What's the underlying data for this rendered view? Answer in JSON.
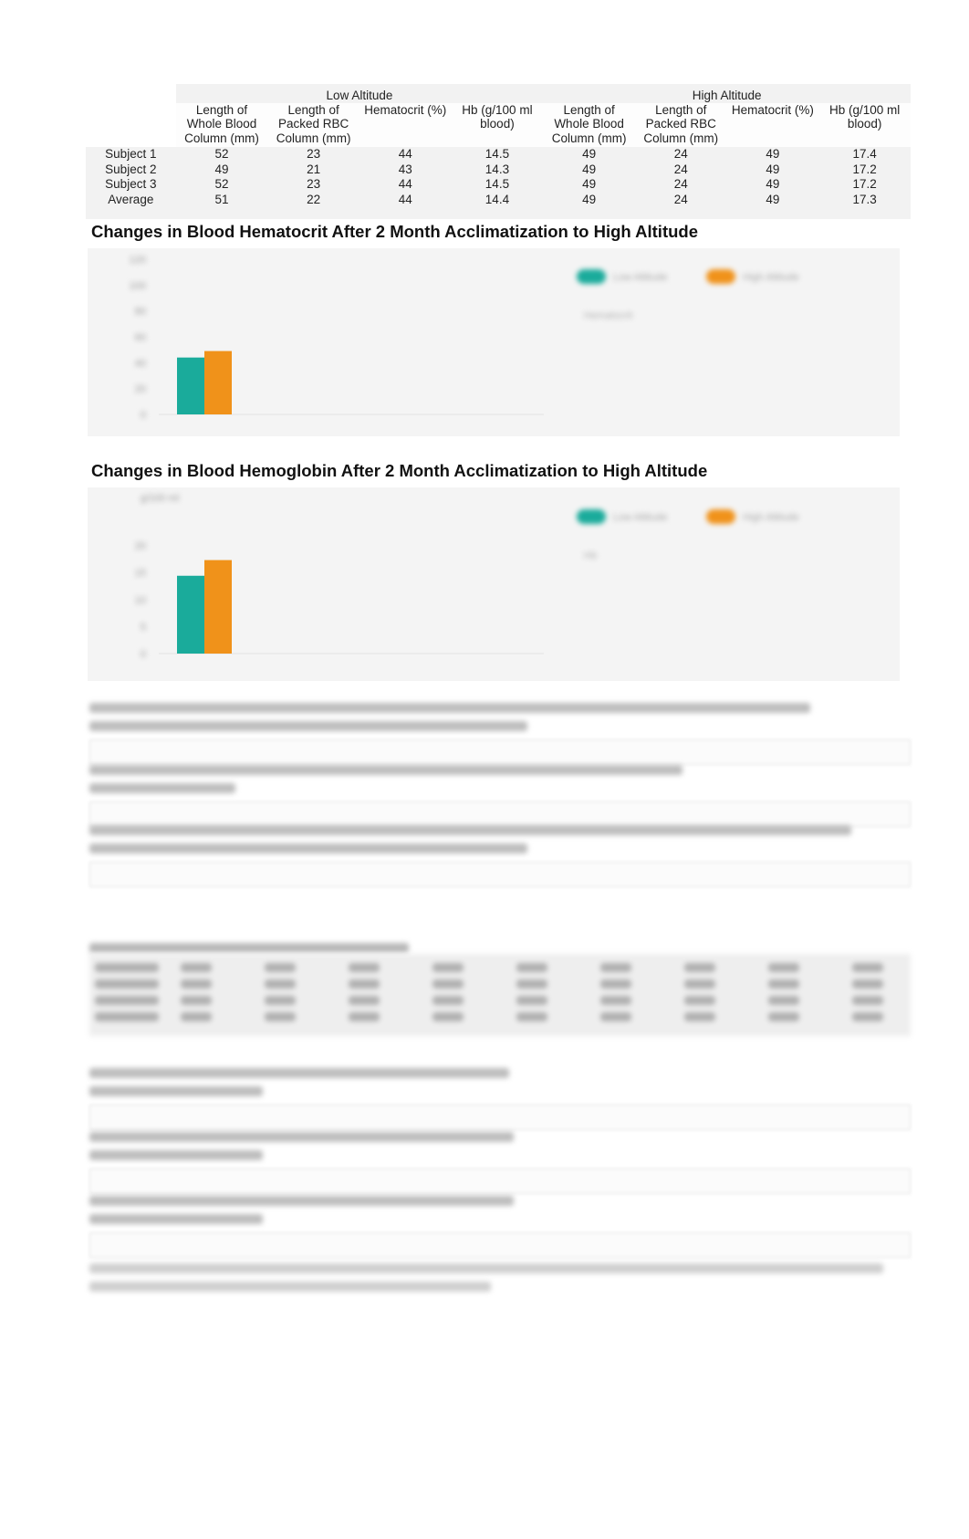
{
  "table": {
    "groups": [
      "Low Altitude",
      "High Altitude"
    ],
    "columns": [
      "Length of Whole Blood Column (mm)",
      "Length of Packed RBC Column (mm)",
      "Hematocrit (%)",
      "Hb (g/100 ml blood)"
    ],
    "column_lines": [
      [
        "Length of",
        "Whole Blood",
        "Column (mm)"
      ],
      [
        "Length of",
        "Packed RBC",
        "Column (mm)"
      ],
      [
        "Hematocrit (%)",
        "",
        ""
      ],
      [
        "Hb (g/100 ml",
        "blood)",
        ""
      ]
    ],
    "rows": [
      {
        "label": "Subject 1",
        "low": [
          "52",
          "23",
          "44",
          "14.5"
        ],
        "high": [
          "49",
          "24",
          "49",
          "17.4"
        ]
      },
      {
        "label": "Subject 2",
        "low": [
          "49",
          "21",
          "43",
          "14.3"
        ],
        "high": [
          "49",
          "24",
          "49",
          "17.2"
        ]
      },
      {
        "label": "Subject 3",
        "low": [
          "52",
          "23",
          "44",
          "14.5"
        ],
        "high": [
          "49",
          "24",
          "49",
          "17.2"
        ]
      },
      {
        "label": "Average",
        "low": [
          "51",
          "22",
          "44",
          "14.4"
        ],
        "high": [
          "49",
          "24",
          "49",
          "17.3"
        ]
      }
    ]
  },
  "colors": {
    "low_altitude": "#1aab9b",
    "high_altitude": "#f0921a",
    "panel_bg": "#f4f4f4"
  },
  "chart_data": [
    {
      "type": "bar",
      "title": "Changes in Blood Hematocrit After 2 Month Acclimatization to High Altitude",
      "categories": [
        ""
      ],
      "series": [
        {
          "name": "Low Altitude",
          "values": [
            44
          ]
        },
        {
          "name": "High Altitude",
          "values": [
            49
          ]
        }
      ],
      "ylim": [
        0,
        120
      ],
      "yticks": [
        0,
        20,
        40,
        60,
        80,
        100,
        120
      ],
      "xlabel": "",
      "ylabel": "",
      "legend": [
        "Low Altitude",
        "High Altitude",
        "Hematocrit"
      ],
      "legend_position": "top-right",
      "grid": false
    },
    {
      "type": "bar",
      "title": "Changes in Blood Hemoglobin After 2 Month Acclimatization to High Altitude",
      "categories": [
        ""
      ],
      "series": [
        {
          "name": "Low Altitude",
          "values": [
            14.4
          ]
        },
        {
          "name": "High Altitude",
          "values": [
            17.3
          ]
        }
      ],
      "ylim": [
        0,
        25
      ],
      "yticks": [
        0,
        5,
        10,
        15,
        20
      ],
      "xlabel": "",
      "ylabel": "g/100 ml",
      "legend": [
        "Low Altitude",
        "High Altitude",
        "Hb"
      ],
      "legend_position": "top-right",
      "grid": false
    }
  ]
}
